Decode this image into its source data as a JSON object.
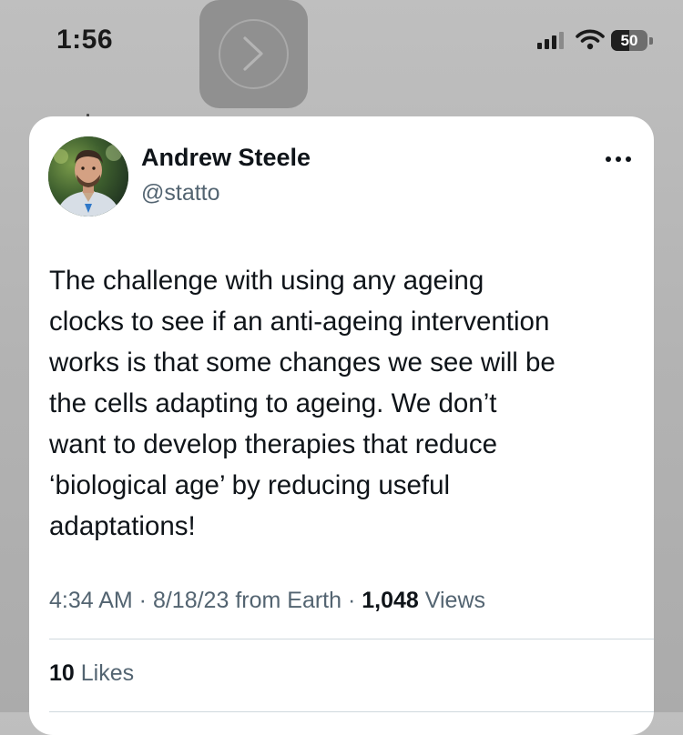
{
  "status_bar": {
    "time": "1:56",
    "battery_level": "50",
    "battery_fraction": 0.5,
    "icons": [
      "cellular-signal-icon",
      "wifi-icon",
      "battery-icon"
    ]
  },
  "overlay": {
    "icon": "chevron-right-icon"
  },
  "tweet": {
    "author": {
      "name": "Andrew Steele",
      "handle": "@statto"
    },
    "more_icon": "more-horizontal-icon",
    "text_lines": [
      "The challenge with using any ageing",
      "clocks to see if an anti-ageing intervention",
      "works is that some changes we see will be",
      "the cells adapting to ageing. We don’t",
      "want to develop therapies that reduce",
      "‘biological age’ by reducing useful",
      "adaptations!"
    ],
    "meta": {
      "time": "4:34 AM",
      "separator": " · ",
      "date": "8/18/23",
      "source": " from Earth",
      "views_count": "1,048",
      "views_label": " Views"
    },
    "likes": {
      "count": "10",
      "label": " Likes"
    }
  },
  "colors": {
    "background": "#b7b7b7",
    "card": "#ffffff",
    "primary_text": "#0f1419",
    "secondary_text": "#536471",
    "divider": "#cfd9de"
  }
}
